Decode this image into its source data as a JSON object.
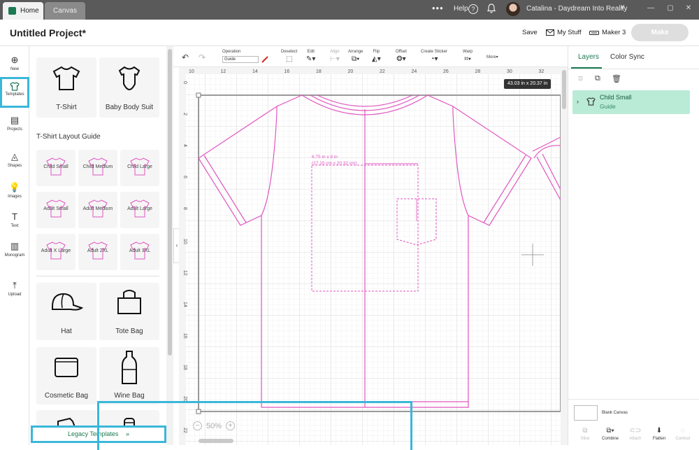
{
  "titlebar": {
    "tab_home": "Home",
    "tab_canvas": "Canvas",
    "dots": "•••",
    "help": "Help",
    "help_icon": "?",
    "user": "Catalina - Daydream Into Reality",
    "chevron": "∨",
    "minimize": "—",
    "maximize": "▢",
    "close": "✕"
  },
  "header": {
    "project_title": "Untitled Project*",
    "save": "Save",
    "my_stuff": "My Stuff",
    "machine": "Maker 3",
    "make": "Make"
  },
  "nav": [
    {
      "label": "New",
      "icon": "⊕"
    },
    {
      "label": "Templates",
      "icon": "👕"
    },
    {
      "label": "Projects",
      "icon": "▤"
    },
    {
      "label": "Shapes",
      "icon": "◬"
    },
    {
      "label": "Images",
      "icon": "💡"
    },
    {
      "label": "Text",
      "icon": "T"
    },
    {
      "label": "Monogram",
      "icon": "▥"
    },
    {
      "label": "Upload",
      "icon": "⤒"
    }
  ],
  "templates": {
    "top_cards": [
      "T-Shirt",
      "Baby Body Suit"
    ],
    "section_title": "T-Shirt Layout Guide",
    "sizes": [
      "Child Small",
      "Child Medium",
      "Child Large",
      "Adult Small",
      "Adult Medium",
      "Adult Large",
      "Adult X Large",
      "Adult 2XL",
      "Adult 3XL"
    ],
    "more_cards": [
      "Hat",
      "Tote Bag",
      "Cosmetic Bag",
      "Wine Bag"
    ],
    "legacy_label": "Legacy Templates",
    "legacy_chevron": "»"
  },
  "toolbar": {
    "operation_label": "Operation",
    "operation_value": "Guide",
    "deselect": "Deselect",
    "edit": "Edit",
    "align": "Align",
    "arrange": "Arrange",
    "flip": "Flip",
    "offset": "Offset",
    "create_sticker": "Create Sticker",
    "warp": "Warp",
    "more": "More▾"
  },
  "canvas": {
    "ruler_top": [
      "10",
      "12",
      "14",
      "16",
      "18",
      "20",
      "22",
      "24",
      "26",
      "28",
      "30",
      "32"
    ],
    "ruler_left": [
      "0",
      "2",
      "4",
      "6",
      "8",
      "10",
      "12",
      "14",
      "16",
      "18",
      "20",
      "22"
    ],
    "dimensions": "43.03  in x 20.37  in",
    "print_area_line1": "6.75 in x 8 in",
    "print_area_line2": "(17.15 cm x 20.32 cm)",
    "zoom": "50%"
  },
  "layers_panel": {
    "tab_layers": "Layers",
    "tab_color_sync": "Color Sync",
    "layer_name": "Child Small",
    "layer_type": "Guide",
    "blank_canvas": "Blank Canvas",
    "actions": [
      "Slice",
      "Combine",
      "Attach",
      "Flatten",
      "Contour"
    ]
  },
  "colors": {
    "brand": "#1c7a52",
    "highlight": "#3ab7d9",
    "guide_pink": "#e055c0",
    "layer_bg": "#b9ebd6"
  }
}
